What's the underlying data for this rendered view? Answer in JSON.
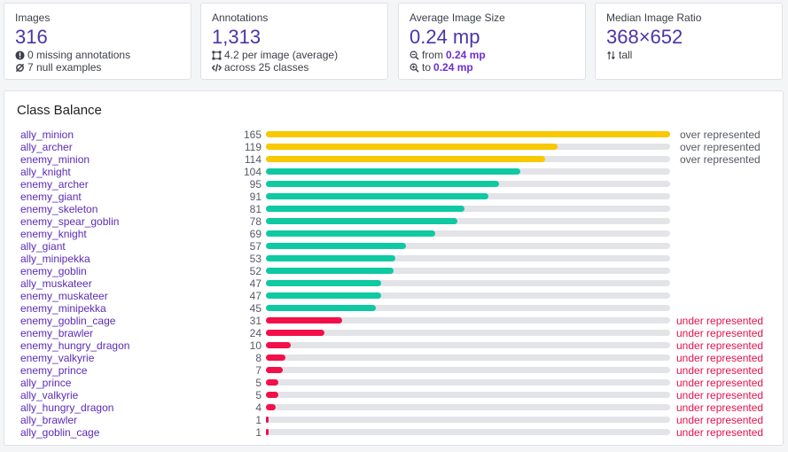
{
  "cards": [
    {
      "title": "Images",
      "value": "316",
      "lines": [
        {
          "icon": "exclamation-circle-icon",
          "pre": "0 missing annotations",
          "bold": ""
        },
        {
          "icon": "empty-set-icon",
          "pre": "7 null examples",
          "bold": ""
        }
      ]
    },
    {
      "title": "Annotations",
      "value": "1,313",
      "lines": [
        {
          "icon": "bounding-box-icon",
          "pre": "4.2 per image (average)",
          "bold": ""
        },
        {
          "icon": "code-icon",
          "pre": "across 25 classes",
          "bold": ""
        }
      ]
    },
    {
      "title": "Average Image Size",
      "value": "0.24 mp",
      "lines": [
        {
          "icon": "zoom-out-icon",
          "pre": "from ",
          "bold": "0.24 mp"
        },
        {
          "icon": "zoom-in-icon",
          "pre": "to ",
          "bold": "0.24 mp"
        }
      ]
    },
    {
      "title": "Median Image Ratio",
      "value": "368×652",
      "lines": [
        {
          "icon": "vertical-arrows-icon",
          "pre": "tall",
          "bold": ""
        }
      ]
    }
  ],
  "class_balance": {
    "title": "Class Balance",
    "max_count": 165,
    "colors": {
      "over": "#f8c800",
      "normal": "#0ec9a2",
      "under": "#f20f4a",
      "over_text": "#555a63",
      "under_text": "#e4104a"
    },
    "rows": [
      {
        "name": "ally_minion",
        "count": 165,
        "level": "over",
        "status": "over represented"
      },
      {
        "name": "ally_archer",
        "count": 119,
        "level": "over",
        "status": "over represented"
      },
      {
        "name": "enemy_minion",
        "count": 114,
        "level": "over",
        "status": "over represented"
      },
      {
        "name": "ally_knight",
        "count": 104,
        "level": "normal",
        "status": ""
      },
      {
        "name": "enemy_archer",
        "count": 95,
        "level": "normal",
        "status": ""
      },
      {
        "name": "enemy_giant",
        "count": 91,
        "level": "normal",
        "status": ""
      },
      {
        "name": "enemy_skeleton",
        "count": 81,
        "level": "normal",
        "status": ""
      },
      {
        "name": "enemy_spear_goblin",
        "count": 78,
        "level": "normal",
        "status": ""
      },
      {
        "name": "enemy_knight",
        "count": 69,
        "level": "normal",
        "status": ""
      },
      {
        "name": "ally_giant",
        "count": 57,
        "level": "normal",
        "status": ""
      },
      {
        "name": "ally_minipekka",
        "count": 53,
        "level": "normal",
        "status": ""
      },
      {
        "name": "enemy_goblin",
        "count": 52,
        "level": "normal",
        "status": ""
      },
      {
        "name": "ally_muskateer",
        "count": 47,
        "level": "normal",
        "status": ""
      },
      {
        "name": "enemy_muskateer",
        "count": 47,
        "level": "normal",
        "status": ""
      },
      {
        "name": "enemy_minipekka",
        "count": 45,
        "level": "normal",
        "status": ""
      },
      {
        "name": "enemy_goblin_cage",
        "count": 31,
        "level": "under",
        "status": "under represented"
      },
      {
        "name": "enemy_brawler",
        "count": 24,
        "level": "under",
        "status": "under represented"
      },
      {
        "name": "enemy_hungry_dragon",
        "count": 10,
        "level": "under",
        "status": "under represented"
      },
      {
        "name": "enemy_valkyrie",
        "count": 8,
        "level": "under",
        "status": "under represented"
      },
      {
        "name": "enemy_prince",
        "count": 7,
        "level": "under",
        "status": "under represented"
      },
      {
        "name": "ally_prince",
        "count": 5,
        "level": "under",
        "status": "under represented"
      },
      {
        "name": "ally_valkyrie",
        "count": 5,
        "level": "under",
        "status": "under represented"
      },
      {
        "name": "ally_hungry_dragon",
        "count": 4,
        "level": "under",
        "status": "under represented"
      },
      {
        "name": "ally_brawler",
        "count": 1,
        "level": "under",
        "status": "under represented"
      },
      {
        "name": "ally_goblin_cage",
        "count": 1,
        "level": "under",
        "status": "under represented"
      }
    ]
  }
}
